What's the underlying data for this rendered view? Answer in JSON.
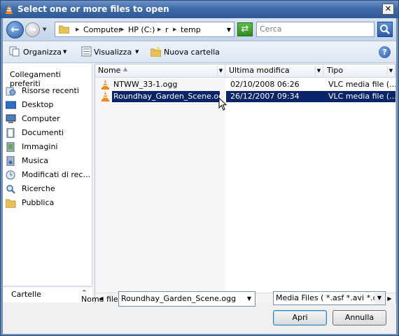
{
  "window": {
    "title": "Select one or more files to open"
  },
  "address": {
    "parts": [
      "Computer",
      "HP (C:)",
      "r",
      "temp"
    ]
  },
  "search": {
    "placeholder": "Cerca"
  },
  "toolbar": {
    "organize": "Organizza",
    "views": "Visualizza",
    "new_folder": "Nuova cartella"
  },
  "navigation": {
    "header": "Collegamenti preferiti",
    "items": [
      {
        "label": "Risorse recenti",
        "icon": "recent-icon"
      },
      {
        "label": "Desktop",
        "icon": "desktop-icon"
      },
      {
        "label": "Computer",
        "icon": "computer-icon"
      },
      {
        "label": "Documenti",
        "icon": "documents-icon"
      },
      {
        "label": "Immagini",
        "icon": "pictures-icon"
      },
      {
        "label": "Musica",
        "icon": "music-icon"
      },
      {
        "label": "Modificati di rec...",
        "icon": "recently-changed-icon"
      },
      {
        "label": "Ricerche",
        "icon": "searches-icon"
      },
      {
        "label": "Pubblica",
        "icon": "public-icon"
      }
    ],
    "folders_label": "Cartelle"
  },
  "filelist": {
    "columns": [
      "Nome",
      "Ultima modifica",
      "Tipo"
    ],
    "rows": [
      {
        "name": "NTWW_33-1.ogg",
        "modified": "02/10/2008 06:26",
        "type": "VLC media file (....",
        "selected": false
      },
      {
        "name": "Roundhay_Garden_Scene.ogg",
        "modified": "26/12/2007 09:34",
        "type": "VLC media file (....",
        "selected": true
      }
    ]
  },
  "footer": {
    "filename_label": "Nome file:",
    "filename_value": "Roundhay_Garden_Scene.ogg",
    "filetype_value": "Media Files ( *.asf *.avi *.divx",
    "open_label": "Apri",
    "cancel_label": "Annulla"
  },
  "colors": {
    "selection": "#0a246a",
    "title_bar": "#3f6aa6"
  }
}
